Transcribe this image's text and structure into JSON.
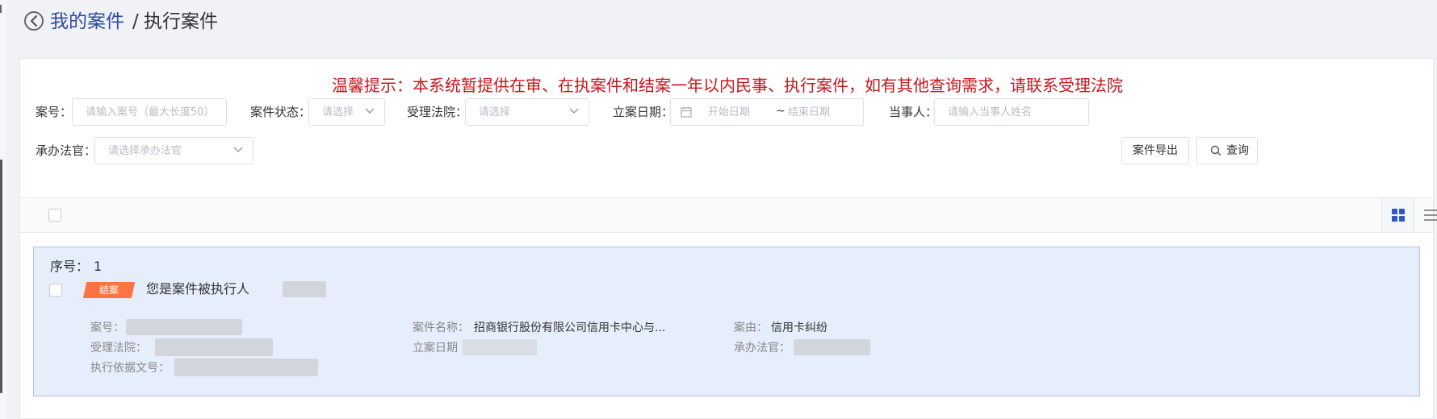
{
  "breadcrumb": {
    "parent": "我的案件",
    "separator": "/",
    "current": "执行案件"
  },
  "notice": "温馨提示：本系统暂提供在审、在执案件和结案一年以内民事、执行案件，如有其他查询需求，请联系受理法院",
  "filters": {
    "case_no": {
      "label": "案号：",
      "placeholder": "请输入案号（最大长度50）"
    },
    "case_status": {
      "label": "案件状态：",
      "placeholder": "请选择"
    },
    "court": {
      "label": "受理法院：",
      "placeholder": "请选择"
    },
    "filing_date": {
      "label": "立案日期：",
      "start_placeholder": "开始日期",
      "separator": "~",
      "end_placeholder": "结束日期"
    },
    "party": {
      "label": "当事人：",
      "placeholder": "请输入当事人姓名"
    },
    "judge": {
      "label": "承办法官：",
      "placeholder": "请选择承办法官"
    }
  },
  "actions": {
    "export_label": "案件导出",
    "query_label": "查询"
  },
  "card": {
    "seq_label": "序号：",
    "seq_value": "1",
    "status_tag": "结案",
    "title": "您是案件被执行人",
    "fields": {
      "case_no_label": "案号：",
      "case_name_label": "案件名称：",
      "case_name_value": "招商银行股份有限公司信用卡中心与...",
      "cause_label": "案由：",
      "cause_value": "信用卡纠纷",
      "court_label": "受理法院：",
      "filing_date_label": "立案日期",
      "judge_label": "承办法官：",
      "basis_label": "执行依据文号："
    }
  },
  "colors": {
    "link": "#2d4aa8",
    "notice": "#c8161d",
    "tag": "#ff7443",
    "card_bg": "#e6edfb",
    "card_border": "#aec3ec",
    "view_icon_active": "#2d56c8"
  }
}
